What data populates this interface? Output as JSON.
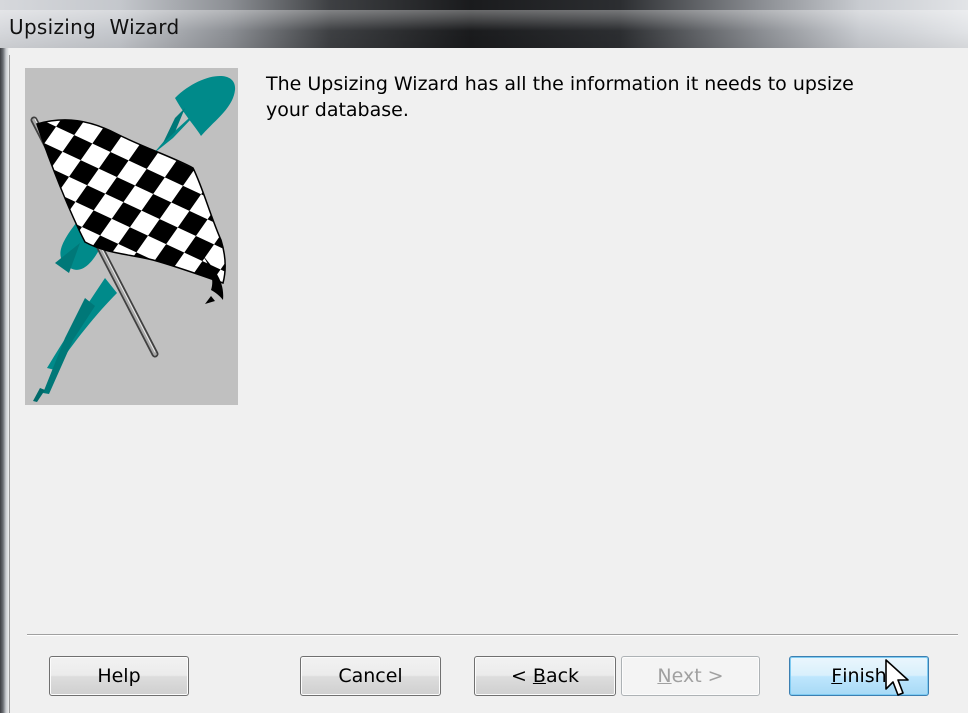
{
  "window": {
    "title": "Upsizing  Wizard"
  },
  "picture": {
    "icon": "checkered-flag-icon",
    "background_color": "#c0c0c0",
    "accent_color": "#008080"
  },
  "message": {
    "text": "The Upsizing Wizard has all the information it needs to upsize your database."
  },
  "buttons": {
    "help": "Help",
    "cancel": "Cancel",
    "back_prefix": "< ",
    "back_mnemonic": "B",
    "back_rest": "ack",
    "next_mnemonic": "N",
    "next_rest": "ext >",
    "finish_mnemonic": "F",
    "finish_rest": "inish"
  },
  "state": {
    "next_enabled": false,
    "default_button": "Finish"
  }
}
